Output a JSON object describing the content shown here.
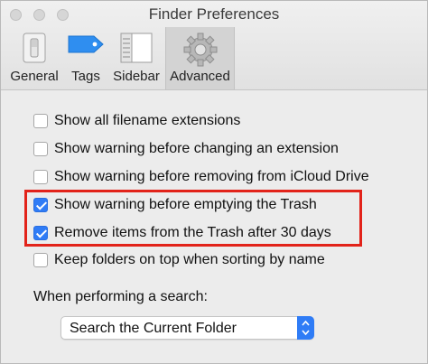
{
  "window": {
    "title": "Finder Preferences"
  },
  "tabs": [
    {
      "label": "General",
      "icon": "general-icon"
    },
    {
      "label": "Tags",
      "icon": "tag-icon"
    },
    {
      "label": "Sidebar",
      "icon": "sidebar-icon"
    },
    {
      "label": "Advanced",
      "icon": "gear-icon",
      "selected": true
    }
  ],
  "options": [
    {
      "label": "Show all filename extensions",
      "checked": false
    },
    {
      "label": "Show warning before changing an extension",
      "checked": false
    },
    {
      "label": "Show warning before removing from iCloud Drive",
      "checked": false
    },
    {
      "label": "Show warning before emptying the Trash",
      "checked": true
    },
    {
      "label": "Remove items from the Trash after 30 days",
      "checked": true
    },
    {
      "label": "Keep folders on top when sorting by name",
      "checked": false
    }
  ],
  "search": {
    "label": "When performing a search:",
    "selected": "Search the Current Folder"
  },
  "colors": {
    "accent": "#2f7cf6",
    "highlight": "#e2231a"
  }
}
